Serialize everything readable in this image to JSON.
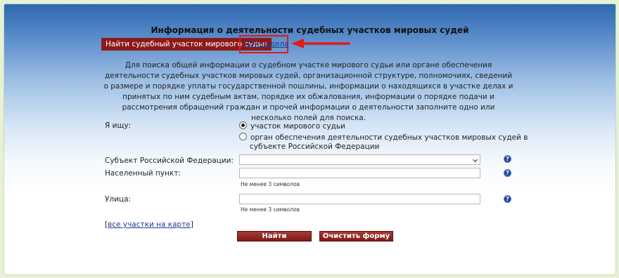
{
  "page": {
    "title": "Информация о деятельности судебных участков мировых судей",
    "accent_color": "#8c1a1a",
    "highlight_color": "#e21a1a"
  },
  "tabs": {
    "active": "Найти судебный участок мирового судьи",
    "other": "Поиск дела"
  },
  "description": "Для поиска общей информации о судебном участке мирового судьи или органе обеспечения деятельности судебных участков мировых судей, организационной структуре, полномочиях, сведений о размере и порядке уплаты государственной пошлины, информации о находящихся в участке делах и принятых по ним судебным актам, порядке их обжалования, информации о порядке подачи и рассмотрения обращений граждан и прочей информации о деятельности заполните одно или несколько полей для поиска.",
  "form": {
    "search_label": "Я ищу:",
    "radio_option_1": "участок мирового судьи",
    "radio_option_2_line1": "орган обеспечения деятельности судебных участков мировых судей в",
    "radio_option_2_line2": "субъекте Российской Федерации",
    "subject_label": "Субъект Российской Федерации:",
    "subject_value": "",
    "city_label": "Населенный пункт:",
    "city_value": "",
    "city_hint": "Не менее 3 символов",
    "street_label": "Улица:",
    "street_value": "",
    "street_hint": "Не менее 3 символов",
    "help_glyph": "?",
    "map_link_open": "[",
    "map_link_text": "все участки на карте",
    "map_link_close": "]"
  },
  "buttons": {
    "find": "Найти",
    "clear": "Очистить форму"
  },
  "icons": {
    "help": "question-icon",
    "annotation_arrow": "arrow-left-icon"
  }
}
